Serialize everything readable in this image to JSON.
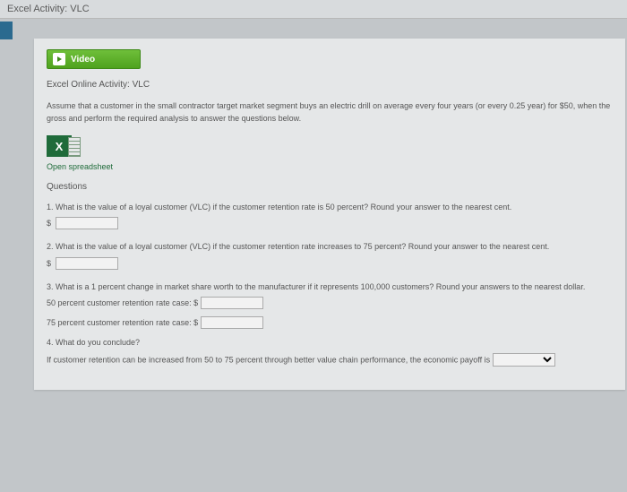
{
  "topbar": {
    "title": "Excel Activity: VLC"
  },
  "video_tab": {
    "label": "Video"
  },
  "subtitle": "Excel Online Activity: VLC",
  "intro": "Assume that a customer in the small contractor target market segment buys an electric drill on average every four years (or every 0.25 year) for $50, when the gross and perform the required analysis to answer the questions below.",
  "excel": {
    "icon_letter": "X",
    "link_text": "Open spreadsheet"
  },
  "questions_heading": "Questions",
  "q1": {
    "text": "1. What is the value of a loyal customer (VLC) if the customer retention rate is 50 percent? Round your answer to the nearest cent.",
    "prefix": "$"
  },
  "q2": {
    "text": "2. What is the value of a loyal customer (VLC) if the customer retention rate increases to 75 percent? Round your answer to the nearest cent.",
    "prefix": "$"
  },
  "q3": {
    "text": "3. What is a 1 percent change in market share worth to the manufacturer if it represents 100,000 customers? Round your answers to the nearest dollar.",
    "line_a_label": "50 percent customer retention rate case: $",
    "line_b_label": "75 percent customer retention rate case: $"
  },
  "q4": {
    "text": "4. What do you conclude?",
    "sentence": "If customer retention can be increased from 50 to 75 percent through better value chain performance, the economic payoff is"
  }
}
